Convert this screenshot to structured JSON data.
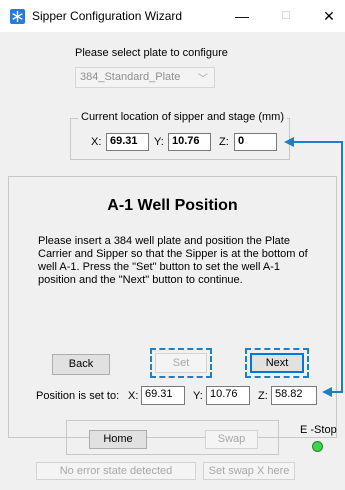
{
  "window": {
    "title": "Sipper Configuration Wizard",
    "minimize": "—",
    "maximize": "☐",
    "close": "✕"
  },
  "plate": {
    "prompt": "Please select plate to configure",
    "selected": "384_Standard_Plate"
  },
  "current_location": {
    "legend": "Current location of sipper and stage (mm)",
    "x_label": "X:",
    "x_value": "69.31",
    "y_label": "Y:",
    "y_value": "10.76",
    "z_label": "Z:",
    "z_value": "0"
  },
  "step": {
    "title": "A-1 Well Position",
    "instructions": "Please insert a 384 well plate and position the Plate Carrier and Sipper so that the Sipper is at the bottom of well A-1. Press the \"Set\" button to set the well A-1 position and the \"Next\" button to continue."
  },
  "buttons": {
    "back": "Back",
    "set": "Set",
    "next": "Next",
    "home": "Home",
    "swap": "Swap",
    "error_state": "No error state detected",
    "set_swap": "Set swap X here"
  },
  "position_set": {
    "label": "Position is set to:",
    "x_label": "X:",
    "x_value": "69.31",
    "y_label": "Y:",
    "y_value": "10.76",
    "z_label": "Z:",
    "z_value": "58.82"
  },
  "estop": {
    "label": "E -Stop",
    "status_color": "#3fd24b"
  },
  "colors": {
    "annotation": "#1f7fc4",
    "window_icon": "#2b79d8"
  }
}
